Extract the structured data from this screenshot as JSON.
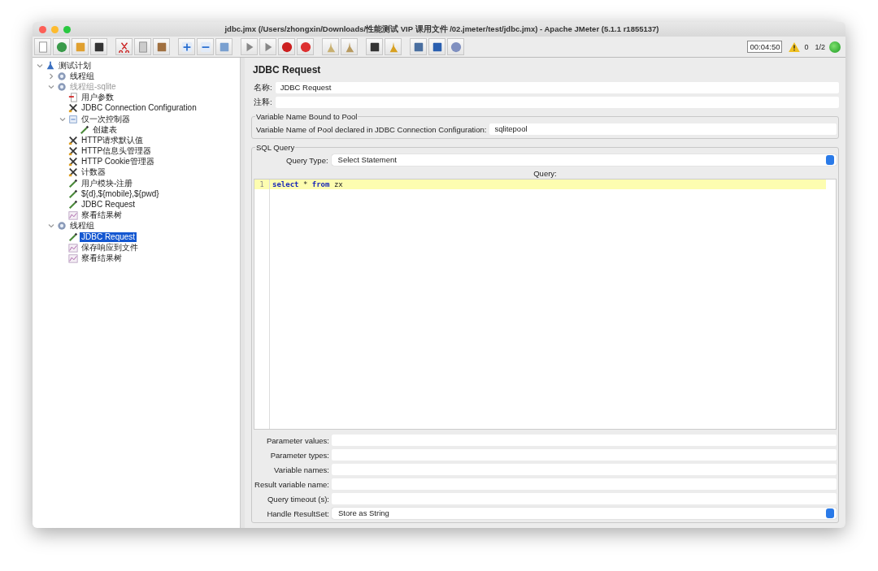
{
  "window": {
    "title": "jdbc.jmx (/Users/zhongxin/Downloads/性能测试 VIP 课用文件 /02.jmeter/test/jdbc.jmx) - Apache JMeter (5.1.1 r1855137)"
  },
  "status": {
    "timer": "00:04:50",
    "warnings": "0",
    "threads": "1/2",
    "running": true
  },
  "tree": [
    {
      "label": "测试计划",
      "kind": "plan",
      "expanded": true,
      "disabled": false,
      "selected": false,
      "children": [
        {
          "label": "线程组",
          "kind": "threadgroup",
          "expanded": false,
          "disabled": false,
          "selected": false
        },
        {
          "label": "线程组-sqlite",
          "kind": "threadgroup",
          "expanded": true,
          "disabled": true,
          "selected": false,
          "children": [
            {
              "label": "用户参数",
              "kind": "preprocessor",
              "disabled": false,
              "selected": false
            },
            {
              "label": "JDBC Connection Configuration",
              "kind": "config",
              "disabled": false,
              "selected": false
            },
            {
              "label": "仅一次控制器",
              "kind": "controller",
              "expanded": true,
              "disabled": false,
              "selected": false,
              "children": [
                {
                  "label": "创建表",
                  "kind": "sampler",
                  "disabled": false,
                  "selected": false
                }
              ]
            },
            {
              "label": "HTTP请求默认值",
              "kind": "config",
              "disabled": false,
              "selected": false
            },
            {
              "label": "HTTP信息头管理器",
              "kind": "config",
              "disabled": false,
              "selected": false
            },
            {
              "label": "HTTP Cookie管理器",
              "kind": "config",
              "disabled": false,
              "selected": false
            },
            {
              "label": "计数器",
              "kind": "config",
              "disabled": false,
              "selected": false
            },
            {
              "label": "用户模块-注册",
              "kind": "sampler",
              "disabled": false,
              "selected": false
            },
            {
              "label": "${d},${mobile},${pwd}",
              "kind": "sampler",
              "disabled": false,
              "selected": false
            },
            {
              "label": "JDBC Request",
              "kind": "sampler",
              "disabled": false,
              "selected": false
            },
            {
              "label": "察看结果树",
              "kind": "listener",
              "disabled": false,
              "selected": false
            }
          ]
        },
        {
          "label": "线程组",
          "kind": "threadgroup",
          "expanded": true,
          "disabled": false,
          "selected": false,
          "children": [
            {
              "label": "JDBC Request",
              "kind": "sampler",
              "disabled": false,
              "selected": true
            },
            {
              "label": "保存响应到文件",
              "kind": "listener",
              "disabled": false,
              "selected": false
            },
            {
              "label": "察看结果树",
              "kind": "listener",
              "disabled": false,
              "selected": false
            }
          ]
        }
      ]
    }
  ],
  "panel": {
    "title": "JDBC Request",
    "name": {
      "label": "名称:",
      "value": "JDBC Request"
    },
    "comments": {
      "label": "注释:"
    },
    "pool": {
      "legend": "Variable Name Bound to Pool",
      "label": "Variable Name of Pool declared in JDBC Connection Configuration:",
      "value": "sqlitepool"
    },
    "sql": {
      "legend": "SQL Query",
      "query_type": {
        "label": "Query Type:",
        "value": "Select Statement"
      },
      "query_label": "Query:",
      "lines": [
        {
          "number": "1",
          "tokens": [
            {
              "text": "select",
              "kind": "keyword"
            },
            {
              "text": " * ",
              "kind": "plain"
            },
            {
              "text": "from",
              "kind": "keyword"
            },
            {
              "text": " zx",
              "kind": "plain"
            }
          ]
        }
      ],
      "params": [
        {
          "label": "Parameter values:",
          "kind": "text"
        },
        {
          "label": "Parameter types:",
          "kind": "text"
        },
        {
          "label": "Variable names:",
          "kind": "text"
        },
        {
          "label": "Result variable name:",
          "kind": "text"
        },
        {
          "label": "Query timeout (s):",
          "kind": "text"
        },
        {
          "label": "Handle ResultSet:",
          "kind": "select",
          "value": "Store as String"
        }
      ]
    }
  }
}
